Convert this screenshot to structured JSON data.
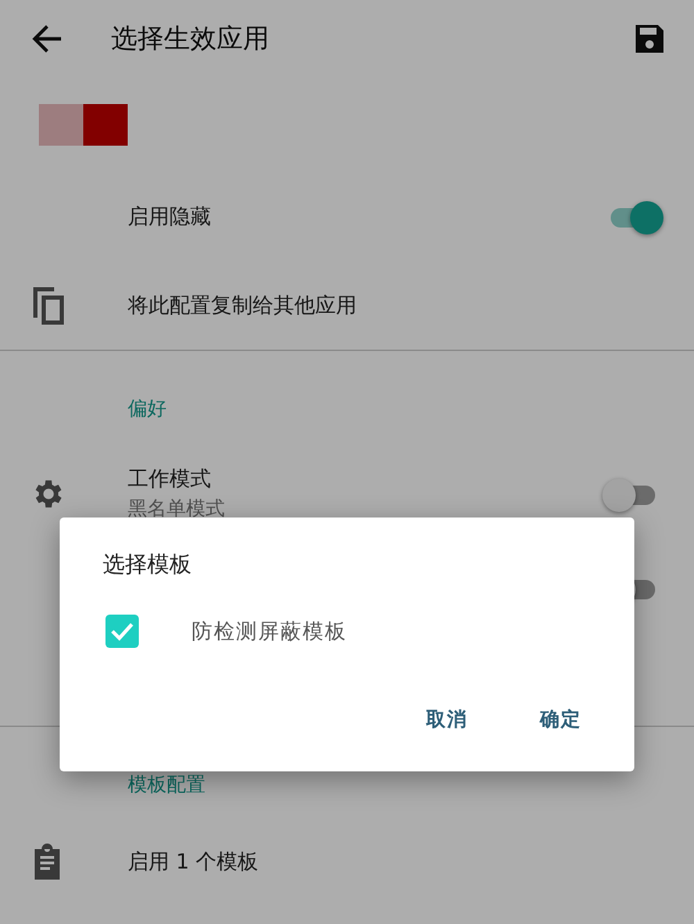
{
  "toolbar": {
    "title": "选择生效应用"
  },
  "rows": [
    {
      "kind": "switch",
      "title": "启用隐藏",
      "on": true
    },
    {
      "kind": "action",
      "title": "将此配置复制给其他应用"
    },
    {
      "kind": "divider"
    },
    {
      "kind": "header",
      "title": "偏好"
    },
    {
      "kind": "switch",
      "title": "工作模式",
      "subtitle": "黑名单模式",
      "on": false
    },
    {
      "kind": "switch",
      "on": false
    },
    {
      "kind": "divider"
    },
    {
      "kind": "header",
      "title": "模板配置"
    },
    {
      "kind": "action",
      "title": "启用 1 个模板"
    }
  ],
  "dialog": {
    "title": "选择模板",
    "options": [
      {
        "label": "防检测屏蔽模板",
        "checked": true
      }
    ],
    "buttons": [
      "取消",
      "确定"
    ]
  }
}
